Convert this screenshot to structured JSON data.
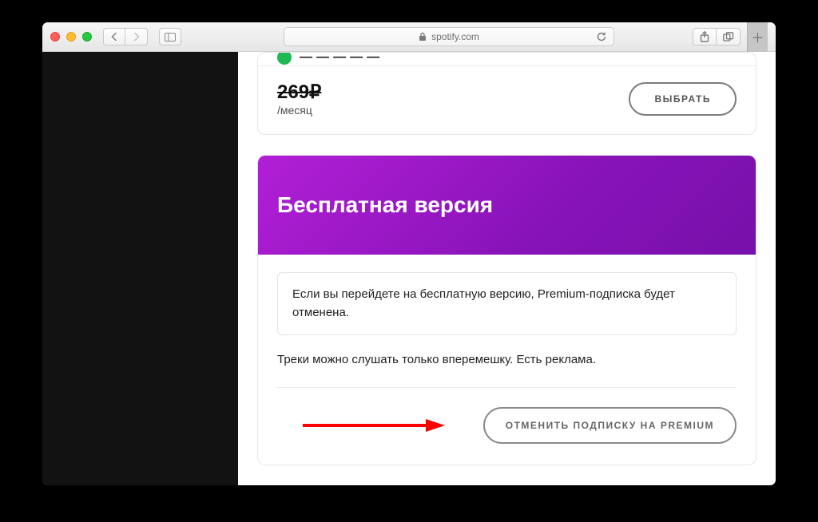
{
  "browser": {
    "host": "spotify.com"
  },
  "prev_plan": {
    "price": "269₽",
    "per": "/месяц",
    "select_label": "ВЫБРАТЬ"
  },
  "free_plan": {
    "title": "Бесплатная версия",
    "notice": "Если вы перейдете на бесплатную версию, Premium-подписка будет отменена.",
    "description": "Треки можно слушать только вперемешку. Есть реклама.",
    "cancel_label": "ОТМЕНИТЬ ПОДПИСКУ НА PREMIUM"
  }
}
